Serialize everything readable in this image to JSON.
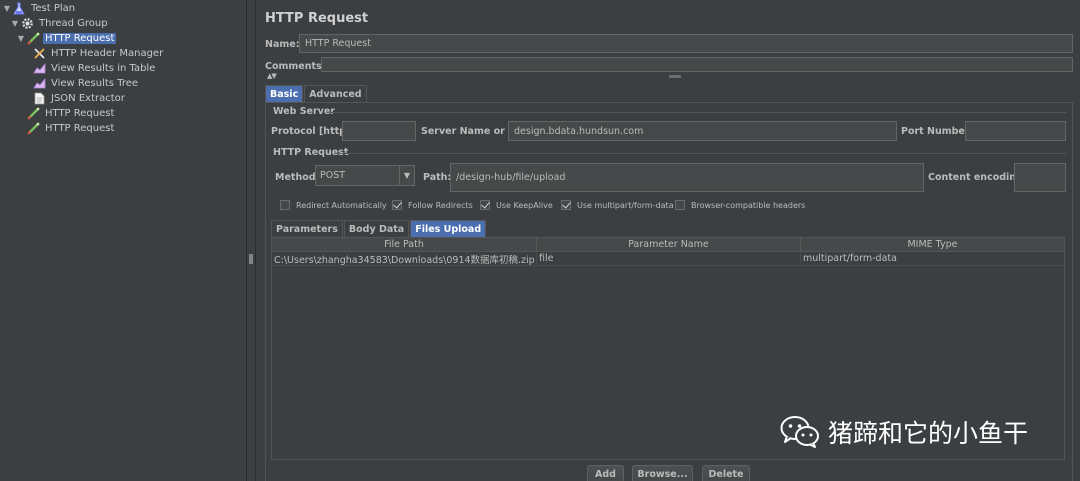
{
  "tree": {
    "items": [
      {
        "label": "Test Plan",
        "icon": "test-plan-icon",
        "expanded": true
      },
      {
        "label": "Thread Group",
        "icon": "gear-icon",
        "expanded": true
      },
      {
        "label": "HTTP Request",
        "icon": "http-sampler-icon",
        "expanded": true,
        "selected": true
      },
      {
        "label": "HTTP Header Manager",
        "icon": "wrench-icon"
      },
      {
        "label": "View Results in Table",
        "icon": "chart-icon"
      },
      {
        "label": "View Results Tree",
        "icon": "chart-icon"
      },
      {
        "label": "JSON Extractor",
        "icon": "document-icon"
      },
      {
        "label": "HTTP Request",
        "icon": "http-sampler-icon"
      },
      {
        "label": "HTTP Request",
        "icon": "http-sampler-icon"
      }
    ]
  },
  "form": {
    "title": "HTTP Request",
    "name_label": "Name:",
    "name_value": "HTTP Request",
    "comments_label": "Comments:",
    "comments_value": "",
    "tabs": [
      "Basic",
      "Advanced"
    ],
    "active_tab": "Basic",
    "web_server": {
      "title": "Web Server",
      "protocol_label": "Protocol [http]:",
      "protocol_value": "",
      "server_label": "Server Name or IP:",
      "server_value": "design.bdata.hundsun.com",
      "port_label": "Port Number:",
      "port_value": ""
    },
    "http_request": {
      "title": "HTTP Request",
      "method_label": "Method:",
      "method_value": "POST",
      "path_label": "Path:",
      "path_value": "/design-hub/file/upload",
      "encoding_label": "Content encoding:",
      "encoding_value": ""
    },
    "checkboxes": [
      {
        "label": "Redirect Automatically",
        "checked": false
      },
      {
        "label": "Follow Redirects",
        "checked": true
      },
      {
        "label": "Use KeepAlive",
        "checked": true
      },
      {
        "label": "Use multipart/form-data",
        "checked": true
      },
      {
        "label": "Browser-compatible headers",
        "checked": false
      }
    ],
    "subtabs": [
      "Parameters",
      "Body Data",
      "Files Upload"
    ],
    "active_subtab": "Files Upload",
    "files_table": {
      "headers": [
        "File Path",
        "Parameter Name",
        "MIME Type"
      ],
      "rows": [
        [
          "C:\\Users\\zhangha34583\\Downloads\\0914数据库初稿.zip",
          "file",
          "multipart/form-data"
        ]
      ]
    },
    "buttons": {
      "add": "Add",
      "browse": "Browse...",
      "delete": "Delete"
    }
  },
  "watermark": {
    "text": "猪蹄和它的小鱼干",
    "icon": "wechat-icon"
  },
  "colors": {
    "background": "#3c3f41",
    "field": "#45494a",
    "selection": "#4b6eaf",
    "text": "#bbbbbb"
  }
}
